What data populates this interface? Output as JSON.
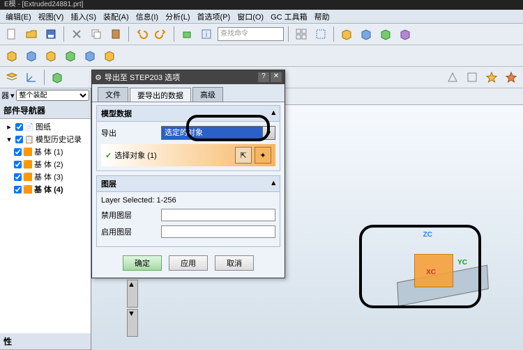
{
  "titlebar": "E模 - [Extruded24881.prt]",
  "menu": [
    "编辑(E)",
    "视图(V)",
    "插入(S)",
    "装配(A)",
    "信息(I)",
    "分析(L)",
    "首选项(P)",
    "窗口(O)",
    "GC 工具箱",
    "帮助"
  ],
  "search_placeholder": "查找命令",
  "left": {
    "filter_label": "器",
    "filter_value": "整个装配",
    "nav_title": "部件导航器",
    "tree": [
      {
        "label": "图纸",
        "checked": true
      },
      {
        "label": "模型历史记录",
        "checked": true
      },
      {
        "label": "基 体 (1)",
        "checked": true,
        "indent": 1
      },
      {
        "label": "基 体 (2)",
        "checked": true,
        "indent": 1
      },
      {
        "label": "基 体 (3)",
        "checked": true,
        "indent": 1
      },
      {
        "label": "基 体 (4)",
        "checked": true,
        "indent": 1,
        "bold": true
      }
    ],
    "section": "性"
  },
  "dialog": {
    "title": "导出至 STEP203 选项",
    "tabs": [
      "文件",
      "要导出的数据",
      "高级"
    ],
    "active_tab": 1,
    "group1": "模型数据",
    "export_label": "导出",
    "export_value": "选定的对象",
    "select_row": "选择对象 (1)",
    "group2": "图层",
    "layer_selected": "Layer Selected: 1-256",
    "disable_layer": "禁用图层",
    "enable_layer": "启用图层",
    "btn_ok": "确定",
    "btn_apply": "应用",
    "btn_cancel": "取消"
  },
  "axes": {
    "z": "ZC",
    "y": "YC",
    "x": "XC"
  }
}
